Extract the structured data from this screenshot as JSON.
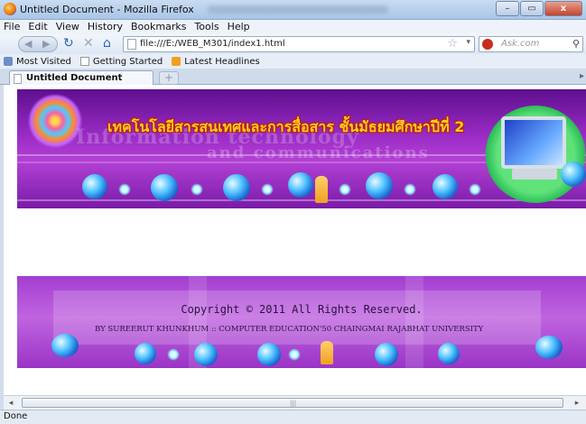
{
  "window": {
    "title": "Untitled Document - Mozilla Firefox",
    "controls": {
      "minimize": "–",
      "maximize": "▭",
      "close": "x"
    }
  },
  "menu": [
    "File",
    "Edit",
    "View",
    "History",
    "Bookmarks",
    "Tools",
    "Help"
  ],
  "navbar": {
    "url": "file:///E:/WEB_M301/index1.html",
    "search_placeholder": "Ask.com"
  },
  "bookmarks": [
    "Most Visited",
    "Getting Started",
    "Latest Headlines"
  ],
  "tabs": [
    {
      "label": "Untitled Document"
    }
  ],
  "page": {
    "header": {
      "thai_title": "เทคโนโลยีสารสนเทศและการสื่อสาร ชั้นมัธยมศึกษาปีที่ 2",
      "english_line1": "Information technology",
      "english_line2": "and communications"
    },
    "footer": {
      "copyright": "Copyright © 2011 All Rights Reserved.",
      "author": "BY SUREERUT KHUNKHUM :: COMPUTER EDUCATION'50  CHAINGMAI RAJABHAT UNIVERSITY"
    }
  },
  "status": "Done",
  "colors": {
    "banner_purple": "#9c2cc6",
    "footer_purple": "#b552dc",
    "thai_title_yellow": "#ffcc22"
  }
}
